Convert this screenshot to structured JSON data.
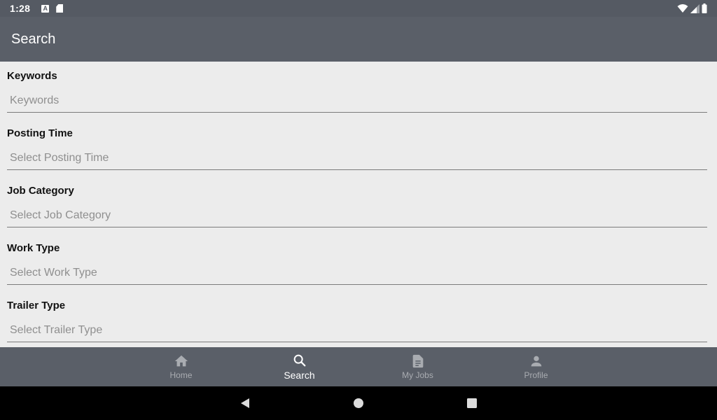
{
  "status_bar": {
    "time": "1:28",
    "notification_icons": [
      "a-letter-icon",
      "sd-card-icon"
    ],
    "system_icons": [
      "wifi-icon",
      "signal-icon",
      "battery-icon"
    ]
  },
  "app_bar": {
    "title": "Search"
  },
  "form": {
    "fields": [
      {
        "label": "Keywords",
        "placeholder": "Keywords"
      },
      {
        "label": "Posting Time",
        "placeholder": "Select Posting Time"
      },
      {
        "label": "Job Category",
        "placeholder": "Select Job Category"
      },
      {
        "label": "Work Type",
        "placeholder": "Select Work Type"
      },
      {
        "label": "Trailer Type",
        "placeholder": "Select Trailer Type"
      }
    ]
  },
  "bottom_nav": {
    "items": [
      {
        "label": "Home",
        "icon": "home-icon",
        "active": false
      },
      {
        "label": "Search",
        "icon": "search-icon",
        "active": true
      },
      {
        "label": "My Jobs",
        "icon": "document-icon",
        "active": false
      },
      {
        "label": "Profile",
        "icon": "person-icon",
        "active": false
      }
    ]
  },
  "system_nav": {
    "buttons": [
      "back-icon",
      "home-circle-icon",
      "recents-icon"
    ]
  },
  "colors": {
    "status_bar": "#555a63",
    "app_bar": "#5a5f68",
    "background": "#ececec",
    "nav_inactive": "#a9acb1",
    "nav_active": "#ffffff"
  }
}
